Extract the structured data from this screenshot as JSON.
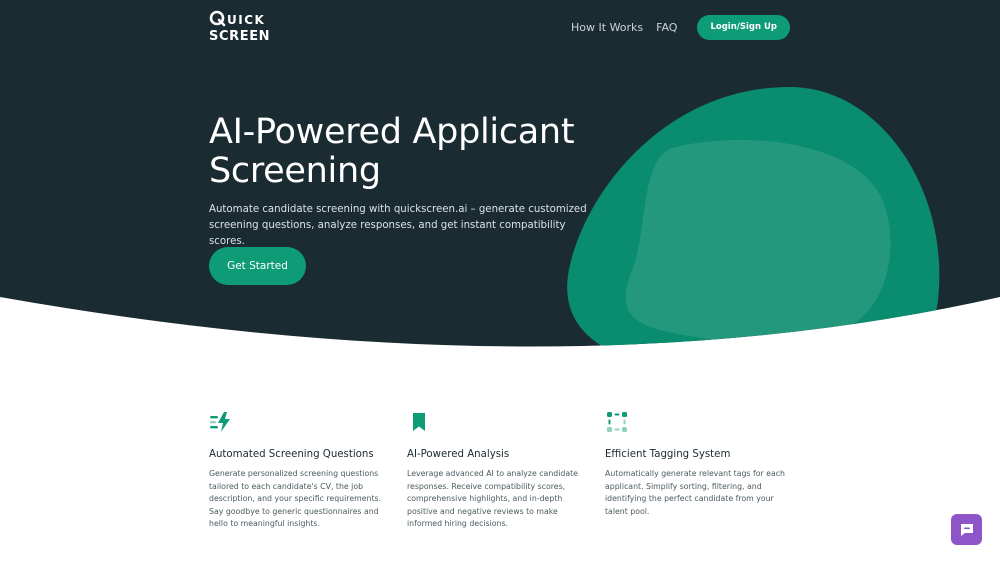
{
  "brand": {
    "logo_top": "UICK",
    "logo_bottom": "SCREEN"
  },
  "nav": {
    "how_it_works": "How It Works",
    "faq": "FAQ",
    "login": "Login/Sign Up"
  },
  "hero": {
    "title_line1": "AI-Powered Applicant",
    "title_line2": "Screening",
    "subtitle": "Automate candidate screening with quickscreen.ai – generate customized screening questions, analyze responses, and get instant compatibility scores.",
    "cta": "Get Started"
  },
  "features": [
    {
      "icon": "lightning-lines-icon",
      "title": "Automated Screening Questions",
      "description": "Generate personalized screening questions tailored to each candidate's CV, the job description, and your specific requirements. Say goodbye to generic questionnaires and hello to meaningful insights."
    },
    {
      "icon": "bookmark-icon",
      "title": "AI-Powered Analysis",
      "description": "Leverage advanced AI to analyze candidate responses. Receive compatibility scores, comprehensive highlights, and in-depth positive and negative reviews to make informed hiring decisions."
    },
    {
      "icon": "dotted-frame-icon",
      "title": "Efficient Tagging System",
      "description": "Automatically generate relevant tags for each applicant. Simplify sorting, filtering, and identifying the perfect candidate from your talent pool."
    }
  ],
  "chat": {
    "icon": "chat-bubble-icon"
  },
  "colors": {
    "hero_bg": "#1b2b32",
    "accent": "#0e9c77",
    "chat": "#8e55c8"
  }
}
